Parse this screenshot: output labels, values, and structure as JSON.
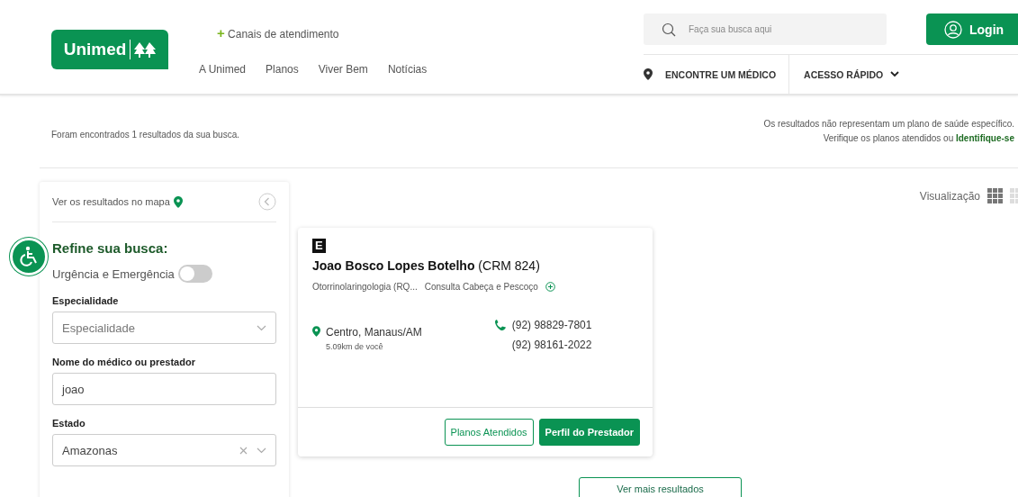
{
  "header": {
    "logo": "Unimed",
    "channels_link": {
      "icon": "+",
      "label": "Canais de atendimento"
    },
    "nav": [
      "A Unimed",
      "Planos",
      "Viver Bem",
      "Notícias"
    ],
    "search": {
      "placeholder": "Faça sua busca aqui"
    },
    "login": "Login",
    "find_doctor": "ENCONTRE UM MÉDICO",
    "quick_access": "ACESSO RÁPIDO"
  },
  "results_count": "Foram encontrados 1 resultados da sua busca.",
  "notice": {
    "line_1": "Os resultados não representam um plano de saúde específico.",
    "line_2": "Verifique os planos atendidos ou",
    "link": "Identifique-se"
  },
  "sidebar": {
    "map_link": "Ver os resultados no mapa",
    "title": "Refine sua busca:",
    "urgency": {
      "label": "Urgência e Emergência",
      "on": false
    },
    "fields": [
      {
        "label": "Especialidade",
        "kind": "select",
        "placeholder": "Especialidade"
      },
      {
        "label": "Nome do médico ou prestador",
        "kind": "text",
        "value": "joao"
      },
      {
        "label": "Estado",
        "kind": "select",
        "value": "Amazonas"
      }
    ]
  },
  "view": {
    "label": "Visualização",
    "options": [
      {
        "kind": "grid",
        "selected": true
      },
      {
        "kind": "list",
        "selected": false
      }
    ]
  },
  "results": [
    {
      "badge": "E",
      "name": "Joao Bosco Lopes Botelho",
      "crm": "(CRM 824)",
      "specialties": [
        "Otorrinolaringologia (RQ...",
        "Consulta Cabeça e Pescoço"
      ],
      "location": "Centro, Manaus/AM",
      "distance": "5.09km de você",
      "phones": [
        "(92) 98829-7801",
        "(92) 98161-2022"
      ],
      "buttons": [
        "Planos Atendidos",
        "Perfil do Prestador"
      ]
    }
  ],
  "more_button": "Ver mais resultados"
}
